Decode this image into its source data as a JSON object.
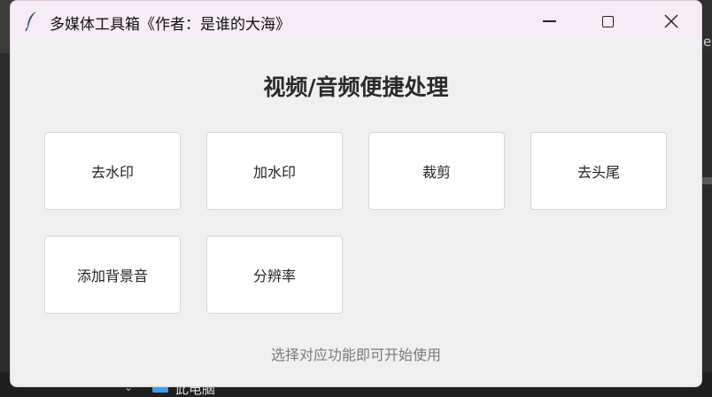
{
  "window": {
    "title": "多媒体工具箱《作者：是谁的大海》"
  },
  "icons": {
    "app": "feather-icon",
    "minimize": "minimize-icon",
    "maximize": "maximize-icon",
    "close": "close-icon"
  },
  "main": {
    "heading": "视频/音频便捷处理",
    "tools": [
      {
        "label": "去水印"
      },
      {
        "label": "加水印"
      },
      {
        "label": "裁剪"
      },
      {
        "label": "去头尾"
      },
      {
        "label": "添加背景音"
      },
      {
        "label": "分辨率"
      }
    ],
    "hint": "选择对应功能即可开始使用"
  },
  "background": {
    "explorer_item": "此电脑",
    "right_edge_text": "es"
  },
  "colors": {
    "titlebar": "#f6ecf6",
    "window_bg": "#f0f0f0",
    "tile_bg": "#ffffff",
    "hint_text": "#7a7a7a"
  }
}
